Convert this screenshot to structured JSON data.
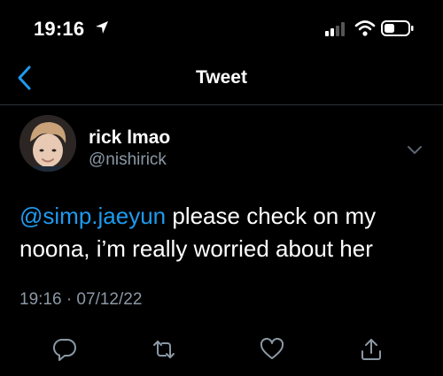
{
  "status_bar": {
    "time": "19:16",
    "icons": [
      "location-arrow-icon",
      "signal-bars-icon",
      "wifi-icon",
      "battery-icon"
    ]
  },
  "nav": {
    "title": "Tweet",
    "back_icon": "chevron-left-icon"
  },
  "tweet": {
    "author_name": "rick lmao",
    "author_handle": "@nishirick",
    "mention": "@simp.jaeyun",
    "text_line1": " please check on my",
    "text_line2": "noona, i’m really worried about her",
    "timestamp": "19:16 · 07/12/22"
  },
  "actions": [
    "reply-icon",
    "retweet-icon",
    "like-icon",
    "share-icon"
  ],
  "colors": {
    "background": "#000000",
    "accent": "#1d9bf0",
    "secondary_text": "#8b98a5",
    "divider": "#2f3336"
  }
}
